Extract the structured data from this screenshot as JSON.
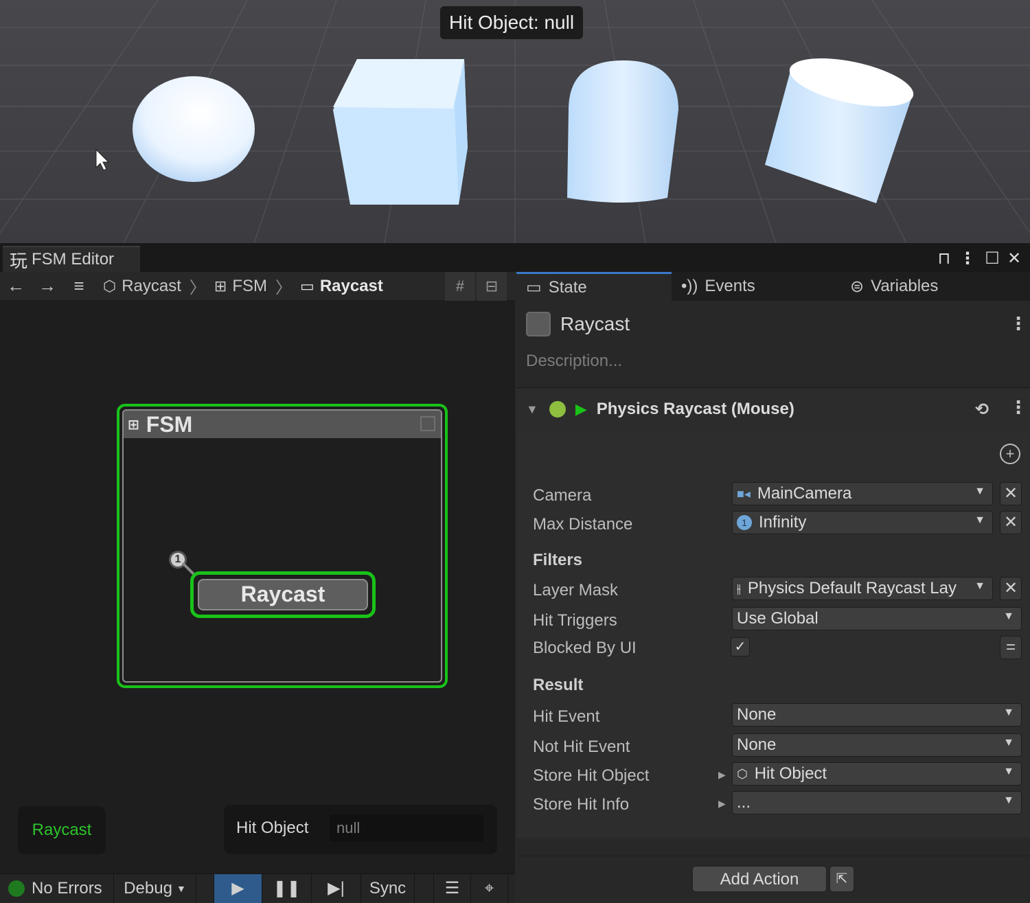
{
  "scene": {
    "hit_label": "Hit Object: null"
  },
  "window": {
    "title": "FSM Editor"
  },
  "toolbar": {
    "breadcrumbs": [
      {
        "label": "Raycast",
        "icon": "cube-icon"
      },
      {
        "label": "FSM",
        "icon": "hierarchy-icon"
      },
      {
        "label": "Raycast",
        "icon": "state-icon"
      }
    ]
  },
  "graph": {
    "fsm_title": "FSM",
    "state_name": "Raycast",
    "active_state_label": "Raycast",
    "watch": {
      "label": "Hit Object",
      "value": "null"
    }
  },
  "bottombar": {
    "status": "No Errors",
    "debug": "Debug",
    "sync": "Sync"
  },
  "inspector": {
    "tabs": [
      "State",
      "Events",
      "Variables"
    ],
    "state_name": "Raycast",
    "description_placeholder": "Description...",
    "action_title": "Physics Raycast (Mouse)",
    "rows": {
      "camera": {
        "label": "Camera",
        "value": "MainCamera"
      },
      "max_distance": {
        "label": "Max Distance",
        "value": "Infinity"
      },
      "filters": "Filters",
      "layer_mask": {
        "label": "Layer Mask",
        "value": "Physics Default Raycast Lay"
      },
      "hit_triggers": {
        "label": "Hit Triggers",
        "value": "Use Global"
      },
      "blocked_by_ui": {
        "label": "Blocked By UI",
        "checked": true
      },
      "result": "Result",
      "hit_event": {
        "label": "Hit Event",
        "value": "None"
      },
      "not_hit_event": {
        "label": "Not Hit Event",
        "value": "None"
      },
      "store_hit_object": {
        "label": "Store Hit Object",
        "value": "Hit Object"
      },
      "store_hit_info": {
        "label": "Store Hit Info",
        "value": "..."
      }
    },
    "add_action": "Add Action"
  },
  "colors": {
    "active_green": "#19c219",
    "accent_blue": "#3a79c9",
    "object_blue": "#cfe8ff"
  }
}
